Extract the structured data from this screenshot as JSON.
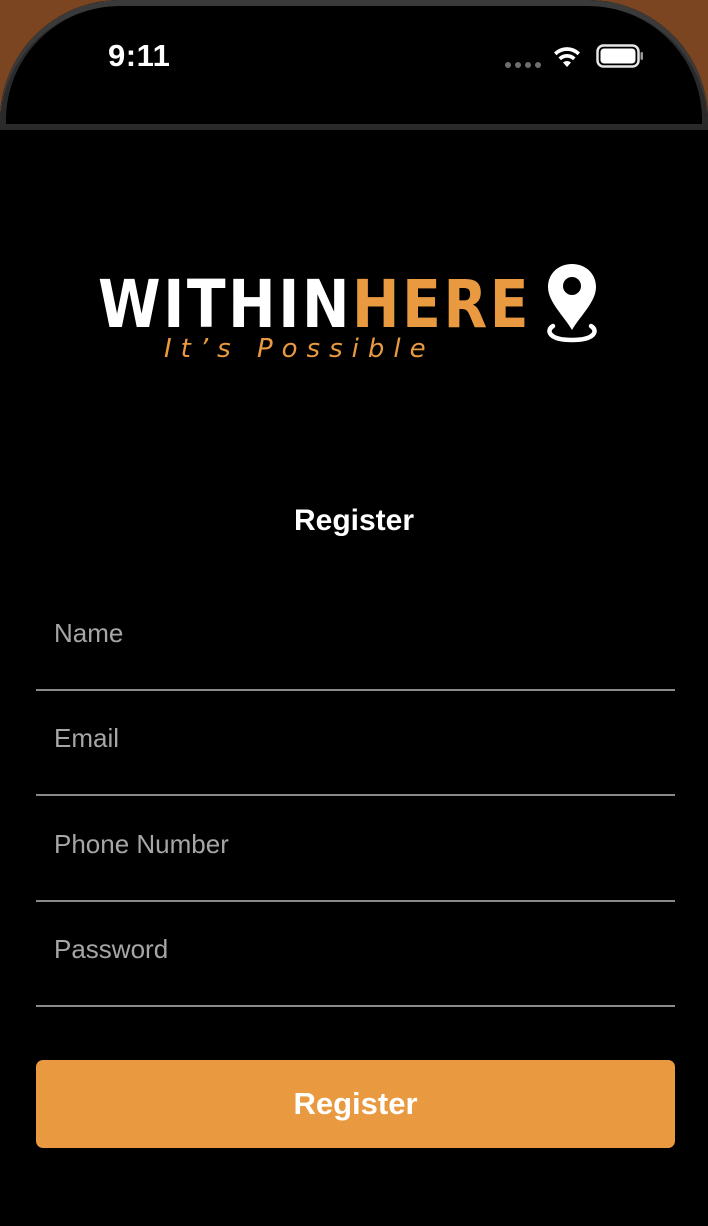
{
  "status_bar": {
    "time": "9:11",
    "icons": [
      "signal-dots-icon",
      "wifi-icon",
      "battery-icon"
    ]
  },
  "logo": {
    "word_white": "WITHIN",
    "word_orange": "HERE",
    "tagline": "It’s Possible",
    "pin_icon": "map-pin-icon"
  },
  "page": {
    "title": "Register"
  },
  "form": {
    "name_placeholder": "Name",
    "name_value": "",
    "email_placeholder": "Email",
    "email_value": "",
    "phone_placeholder": "Phone Number",
    "phone_value": "",
    "password_placeholder": "Password",
    "password_value": "",
    "submit_label": "Register"
  },
  "colors": {
    "background": "#000000",
    "accent": "#e99a40",
    "text": "#ffffff",
    "placeholder": "#a6a6a6",
    "divider": "#8a8a8a"
  }
}
